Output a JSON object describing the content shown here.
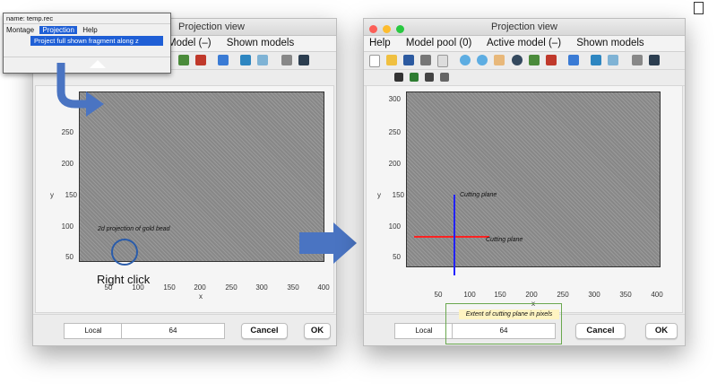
{
  "left_window": {
    "title": "Projection view",
    "menu": [
      "Model (–)",
      "Shown models"
    ]
  },
  "popup": {
    "filename": "name: temp.rec",
    "menu": [
      "Montage",
      "Projection",
      "Help"
    ],
    "item": "Project full shown fragment along z"
  },
  "right_window": {
    "title": "Projection view",
    "menu": [
      "Help",
      "Model pool (0)",
      "Active model (–)",
      "Shown models"
    ]
  },
  "plot": {
    "y_ticks": [
      "300",
      "250",
      "200",
      "150",
      "100",
      "50"
    ],
    "x_ticks": [
      "50",
      "100",
      "150",
      "200",
      "250",
      "300",
      "350",
      "400"
    ],
    "xlabel": "x",
    "ylabel": "y"
  },
  "annotations": {
    "gold_bead": "2d projection of gold bead",
    "right_click": "Right click",
    "cutting_plane_v": "Cutting plane",
    "cutting_plane_h": "Cutting plane",
    "extent": "Extent of cutting plane in pixels"
  },
  "footer": {
    "local_label": "Local",
    "local_value": "64",
    "cancel": "Cancel",
    "ok": "OK"
  },
  "colors": {
    "accent": "#1f5fd6",
    "arrow": "#4a74c2",
    "horizontal_line": "#ff2222",
    "vertical_line": "#2222ff",
    "highlight_box": "#6aa84f",
    "note_bg": "#fff4c2"
  }
}
